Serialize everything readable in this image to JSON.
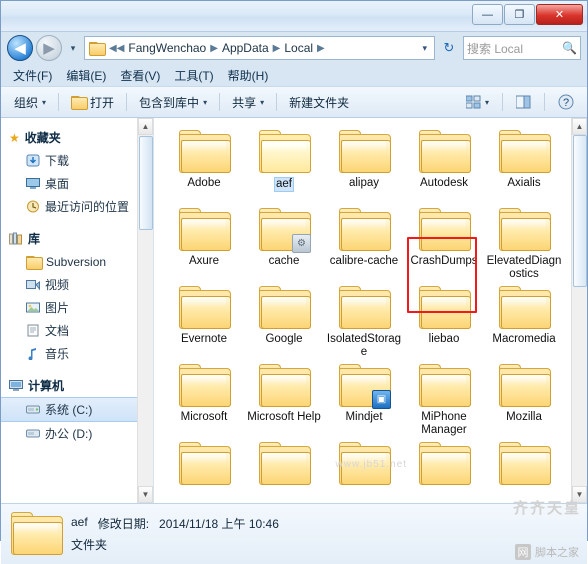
{
  "window": {
    "minimize_label": "—",
    "maximize_label": "❐",
    "close_label": "✕"
  },
  "address": {
    "back_label": "◀",
    "forward_label": "▶",
    "history_label": "▾",
    "folder_icon": "folder-icon",
    "crumbs": [
      "FangWenchao",
      "AppData",
      "Local"
    ],
    "leading_sep": "◀◀",
    "separator": "▶",
    "dropdown_label": "▾",
    "refresh_label": "↻",
    "search_placeholder": "搜索 Local",
    "search_icon": "🔍"
  },
  "menubar": {
    "items": [
      "文件(F)",
      "编辑(E)",
      "查看(V)",
      "工具(T)",
      "帮助(H)"
    ]
  },
  "toolbar": {
    "organize": "组织",
    "open": "打开",
    "include_in_library": "包含到库中",
    "share": "共享",
    "new_folder": "新建文件夹",
    "view_icon": "view-icon",
    "preview_icon": "preview-pane-icon",
    "help_icon": "?",
    "caret": "▾"
  },
  "navpane": {
    "groups": [
      {
        "title": "收藏夹",
        "icon": "star-icon",
        "items": [
          {
            "label": "下载",
            "icon": "download-icon"
          },
          {
            "label": "桌面",
            "icon": "desktop-icon"
          },
          {
            "label": "最近访问的位置",
            "icon": "recent-icon"
          }
        ]
      },
      {
        "title": "库",
        "icon": "library-icon",
        "items": [
          {
            "label": "Subversion",
            "icon": "folder-icon"
          },
          {
            "label": "视频",
            "icon": "video-icon"
          },
          {
            "label": "图片",
            "icon": "picture-icon"
          },
          {
            "label": "文档",
            "icon": "document-icon"
          },
          {
            "label": "音乐",
            "icon": "music-icon"
          }
        ]
      },
      {
        "title": "计算机",
        "icon": "computer-icon",
        "items": [
          {
            "label": "系统 (C:)",
            "icon": "drive-icon",
            "selected": true
          },
          {
            "label": "办公 (D:)",
            "icon": "drive-icon"
          }
        ]
      }
    ]
  },
  "files": {
    "items": [
      {
        "name": "Adobe",
        "icon": "folder-icon",
        "selected": false
      },
      {
        "name": "aef",
        "icon": "folder-open-icon",
        "selected": true
      },
      {
        "name": "alipay",
        "icon": "folder-icon",
        "selected": false
      },
      {
        "name": "Autodesk",
        "icon": "folder-icon",
        "selected": false
      },
      {
        "name": "Axialis",
        "icon": "folder-icon",
        "selected": false
      },
      {
        "name": "Axure",
        "icon": "folder-icon",
        "selected": false
      },
      {
        "name": "cache",
        "icon": "folder-gear-icon",
        "selected": false
      },
      {
        "name": "calibre-cache",
        "icon": "folder-icon",
        "selected": false
      },
      {
        "name": "CrashDumps",
        "icon": "folder-icon",
        "selected": false
      },
      {
        "name": "ElevatedDiagnostics",
        "icon": "folder-icon",
        "selected": false
      },
      {
        "name": "Evernote",
        "icon": "folder-icon",
        "selected": false
      },
      {
        "name": "Google",
        "icon": "folder-icon",
        "selected": false
      },
      {
        "name": "IsolatedStorage",
        "icon": "folder-icon",
        "selected": false
      },
      {
        "name": "liebao",
        "icon": "folder-icon",
        "selected": false
      },
      {
        "name": "Macromedia",
        "icon": "folder-icon",
        "selected": false
      },
      {
        "name": "Microsoft",
        "icon": "folder-icon",
        "selected": false
      },
      {
        "name": "Microsoft Help",
        "icon": "folder-icon",
        "selected": false
      },
      {
        "name": "Mindjet",
        "icon": "folder-blue-icon",
        "selected": false
      },
      {
        "name": "MiPhone Manager",
        "icon": "folder-icon",
        "selected": false
      },
      {
        "name": "Mozilla",
        "icon": "folder-icon",
        "selected": false
      }
    ]
  },
  "details": {
    "name": "aef",
    "modified_label": "修改日期:",
    "modified_value": "2014/11/18 上午 10:46",
    "type": "文件夹"
  },
  "watermark": {
    "line1": "www.jb51.net",
    "line2": "齐齐天皇",
    "badge": "网",
    "badge_text": "脚本之家"
  },
  "colors": {
    "accent": "#2f86d8",
    "selection_box": "#f01a1a",
    "folder": "#fcd77a"
  }
}
